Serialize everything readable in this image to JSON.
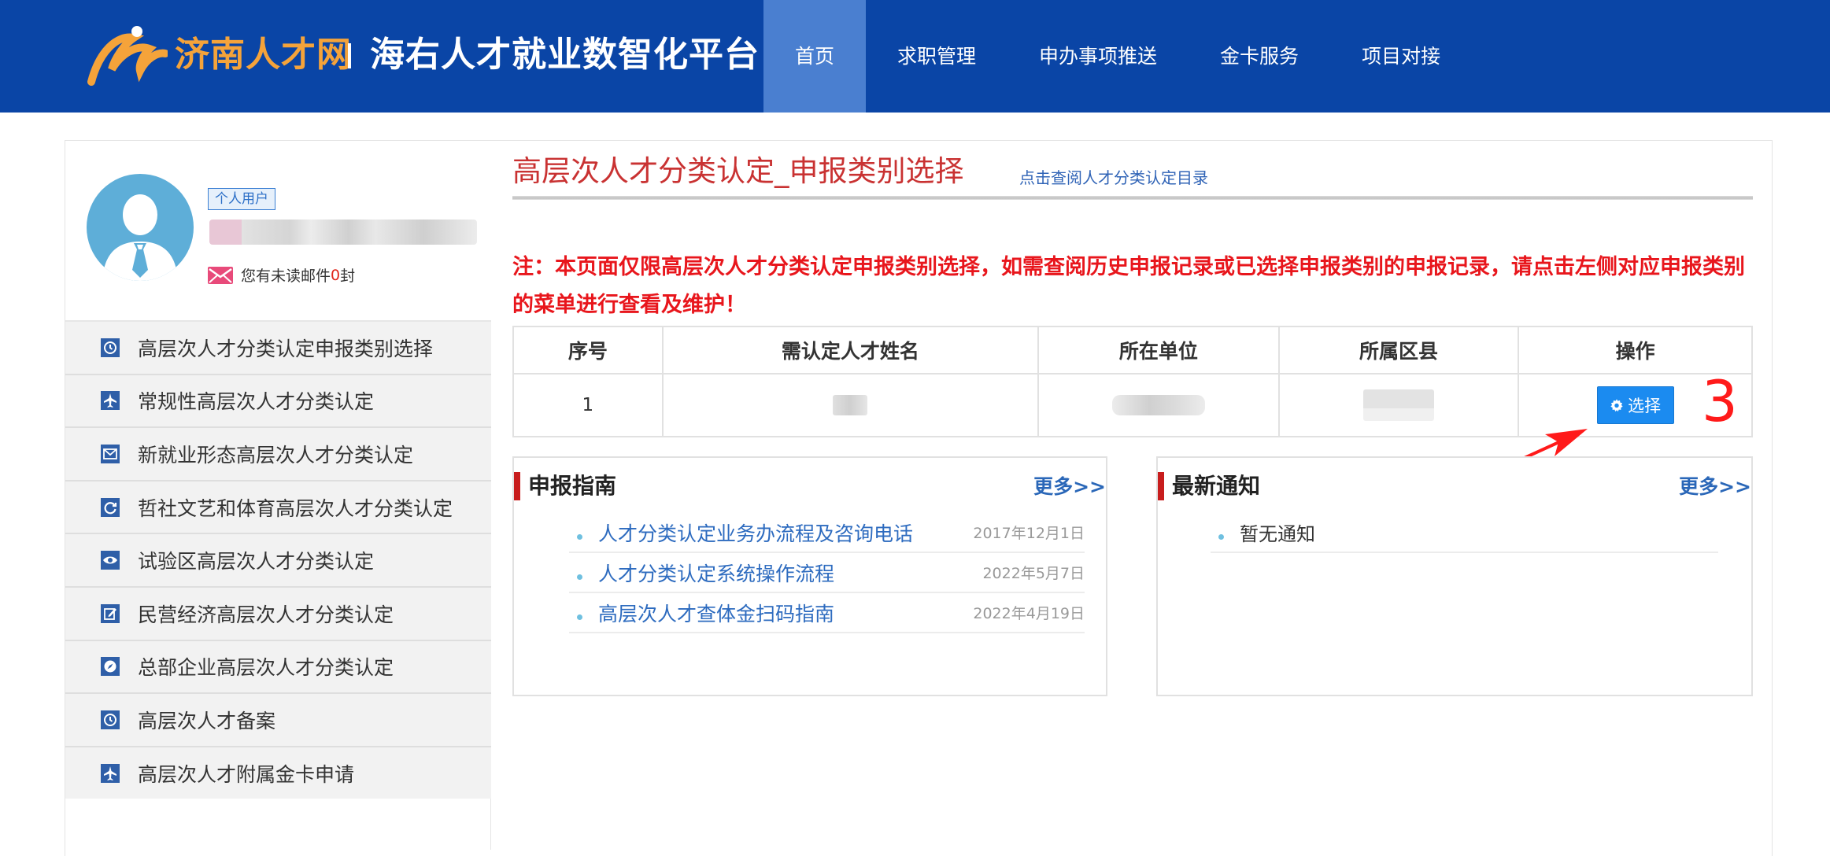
{
  "header": {
    "site_name": "济南人才网",
    "platform_name": "海右人才就业数智化平台",
    "nav": [
      {
        "label": "首页",
        "active": true
      },
      {
        "label": "求职管理",
        "active": false
      },
      {
        "label": "申办事项推送",
        "active": false
      },
      {
        "label": "金卡服务",
        "active": false
      },
      {
        "label": "项目对接",
        "active": false
      }
    ]
  },
  "profile": {
    "user_type": "个人用户",
    "mail_prefix": "您有未读邮件",
    "mail_count": "0",
    "mail_suffix": "封"
  },
  "sidebar": {
    "items": [
      {
        "label": "高层次人才分类认定申报类别选择",
        "icon": "clock-icon"
      },
      {
        "label": "常规性高层次人才分类认定",
        "icon": "plane-icon"
      },
      {
        "label": "新就业形态高层次人才分类认定",
        "icon": "envelope-icon"
      },
      {
        "label": "哲社文艺和体育高层次人才分类认定",
        "icon": "refresh-icon"
      },
      {
        "label": "试验区高层次人才分类认定",
        "icon": "eye-icon"
      },
      {
        "label": "民营经济高层次人才分类认定",
        "icon": "edit-icon"
      },
      {
        "label": "总部企业高层次人才分类认定",
        "icon": "compass-icon"
      },
      {
        "label": "高层次人才备案",
        "icon": "clock-icon"
      },
      {
        "label": "高层次人才附属金卡申请",
        "icon": "plane-icon"
      }
    ]
  },
  "main": {
    "title": "高层次人才分类认定_申报类别选择",
    "title_link": "点击查阅人才分类认定目录",
    "notice": "注：本页面仅限高层次人才分类认定申报类别选择，如需查阅历史申报记录或已选择申报类别的申报记录，请点击左侧对应申报类别的菜单进行查看及维护！",
    "table": {
      "headers": [
        "序号",
        "需认定人才姓名",
        "所在单位",
        "所属区县",
        "操作"
      ],
      "rows": [
        {
          "index": "1",
          "action_label": "选择"
        }
      ]
    },
    "annotation_number": "3"
  },
  "guide_panel": {
    "title": "申报指南",
    "more": "更多>>",
    "items": [
      {
        "text": "人才分类认定业务办流程及咨询电话",
        "date": "2017年12月1日"
      },
      {
        "text": "人才分类认定系统操作流程",
        "date": "2022年5月7日"
      },
      {
        "text": "高层次人才查体金扫码指南",
        "date": "2022年4月19日"
      }
    ]
  },
  "news_panel": {
    "title": "最新通知",
    "more": "更多>>",
    "items": [
      {
        "text": "暂无通知"
      }
    ]
  },
  "colors": {
    "header_bg": "#0a45a6",
    "nav_active_bg": "#4a7fd0",
    "logo_orange": "#f5a33a",
    "title_red": "#c93232",
    "notice_red": "#e8161c",
    "link_blue": "#2d6bbf",
    "button_blue": "#1b8bf0"
  }
}
